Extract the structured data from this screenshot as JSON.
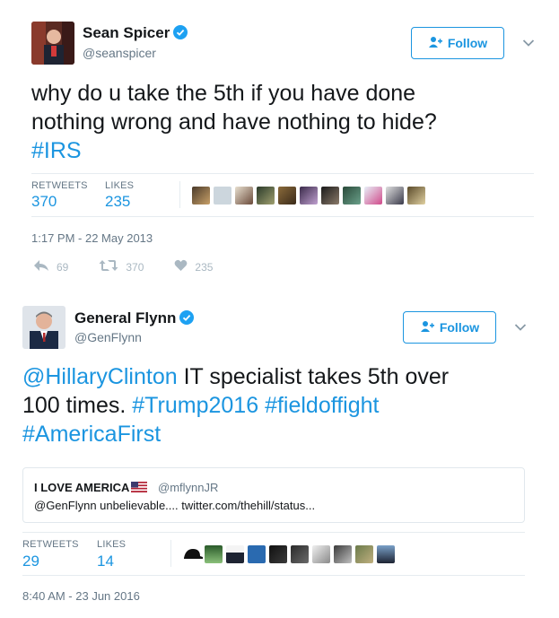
{
  "tweets": [
    {
      "name": "Sean Spicer",
      "handle": "@seanspicer",
      "follow_label": "Follow",
      "text_line1": "why do u take the 5th if you have done",
      "text_line2": "nothing wrong and have nothing to hide?",
      "hashtag": "#IRS",
      "retweets_label": "RETWEETS",
      "retweets": "370",
      "likes_label": "LIKES",
      "likes": "235",
      "timestamp": "1:17 PM - 22 May 2013",
      "reply_count": "69",
      "retweet_count": "370",
      "like_count": "235"
    },
    {
      "name": "General Flynn",
      "handle": "@GenFlynn",
      "follow_label": "Follow",
      "mention": "@HillaryClinton",
      "text_a": " IT specialist takes 5th over",
      "text_b": "100 times. ",
      "tag1": "#Trump2016",
      "tag2": "#fieldoffight",
      "tag3": "#AmericaFirst",
      "quote": {
        "name": "I LOVE AMERICA",
        "flag": "🇺🇸",
        "handle": "@mflynnJR",
        "text": "@GenFlynn unbelievable.... twitter.com/thehill/status..."
      },
      "retweets_label": "RETWEETS",
      "retweets": "29",
      "likes_label": "LIKES",
      "likes": "14",
      "timestamp": "8:40 AM - 23 Jun 2016"
    }
  ],
  "colors": {
    "accent": "#1b95e0",
    "muted": "#657786",
    "border": "#e6ecf0"
  }
}
